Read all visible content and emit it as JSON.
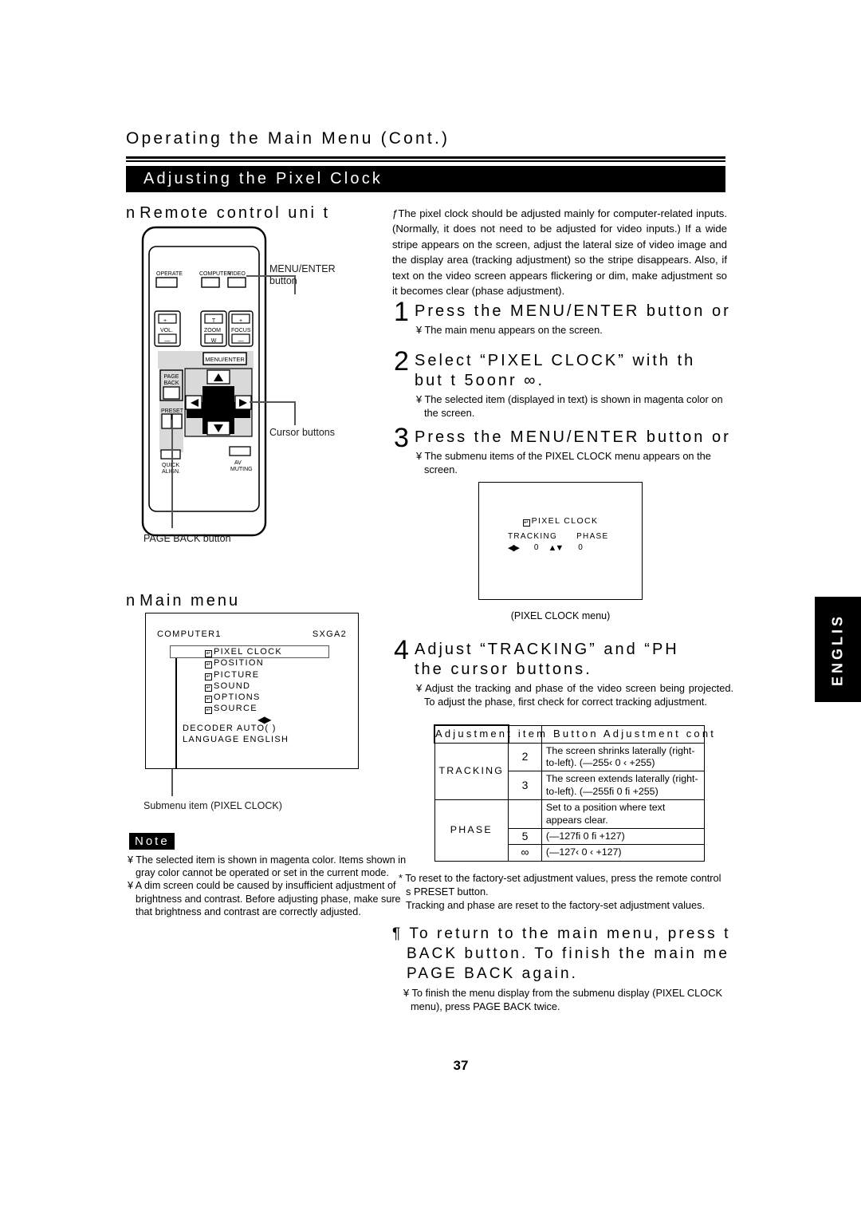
{
  "header": {
    "running_head": "Operating the Main Menu (Cont.)",
    "section_title": "Adjusting the Pixel Clock"
  },
  "left_column": {
    "remote_heading_bullet": "n",
    "remote_heading": "Remote control uni t",
    "mainmenu_heading_bullet": "n",
    "mainmenu_heading": "Main menu",
    "callouts": {
      "menu_enter": "MENU/ENTER\nbutton",
      "cursor": "Cursor buttons",
      "page_back": "PAGE BACK button",
      "submenu": "Submenu item (PIXEL CLOCK)"
    },
    "remote_labels": {
      "operate": "OPERATE",
      "computer": "COMPUTER",
      "video": "VIDEO",
      "vol": "VOL.",
      "zoom": "ZOOM",
      "focus": "FOCUS",
      "zoom_t": "T",
      "zoom_w": "W",
      "plus": "+",
      "minus": "—",
      "menu_enter": "MENU/ENTER",
      "page_back": "PAGE\nBACK",
      "preset": "PRESET",
      "quick_align": "QUICK\nALIGN.",
      "av_muting": "AV\nMUTING"
    },
    "osd_main": {
      "source": "COMPUTER1",
      "mode": "SXGA2",
      "items": [
        "PIXEL CLOCK",
        "POSITION",
        "PICTURE",
        "SOUND",
        "OPTIONS",
        "SOURCE"
      ],
      "selected_item": "PIXEL CLOCK",
      "arrows": "◀▶",
      "decoder": "DECODER AUTO(       )",
      "language": "LANGUAGE ENGLISH"
    },
    "note": {
      "label": "Note",
      "lines": [
        "¥ The selected item is shown in magenta color. Items shown in gray color cannot be operated or set in the current mode.",
        "¥ A dim screen could be caused by insufficient adjustment of brightness and contrast. Before adjusting phase, make sure that brightness and contrast are correctly adjusted."
      ]
    }
  },
  "right_column": {
    "intro": "ƒThe pixel clock should be adjusted mainly for computer-related inputs. (Normally, it does not need to be adjusted for video inputs.) If a wide stripe appears on the screen, adjust the lateral size of video image and the display area (tracking adjustment) so the stripe disappears. Also, if text on the video screen appears flickering or dim, make adjustment so it becomes clear (phase adjustment).",
    "steps": [
      {
        "num": "1",
        "title": "Press the MENU/ENTER button or",
        "sub": "¥ The main menu appears on the screen."
      },
      {
        "num": "2",
        "title": "Select “PIXEL CLOCK” with th",
        "title2": "but t 5oonr ∞.",
        "sub": "¥ The selected item (displayed in text) is shown in magenta color on the screen."
      },
      {
        "num": "3",
        "title": "Press the MENU/ENTER button or",
        "sub": "¥ The submenu items of the PIXEL CLOCK menu appears on the screen."
      },
      {
        "num": "4",
        "title": "Adjust “TRACKING” and “PH",
        "title2": "the cursor buttons.",
        "sub": "¥ Adjust the tracking and phase of the video screen being projected. To adjust the phase, first check for correct tracking adjustment."
      }
    ],
    "osd_pixel": {
      "title": "PIXEL CLOCK",
      "tracking_label": "TRACKING",
      "phase_label": "PHASE",
      "tracking_arrow": "◀▶",
      "tracking_value": "0",
      "phase_arrow": "▲▼",
      "phase_value": "0",
      "caption": "(PIXEL CLOCK menu)"
    },
    "lang_tab": "ENGLIS",
    "adj_table": {
      "header_text": "Adjustment item  Button        Adjustment cont",
      "columns": [
        "Adjustment item",
        "Button",
        "Adjustment content"
      ],
      "rows": [
        {
          "item": "TRACKING",
          "button": "2",
          "desc": "The screen shrinks laterally (right-to-left). (—255‹  0 ‹  +255)"
        },
        {
          "item": "",
          "button": "3",
          "desc": "The screen extends laterally (right-to-left). (—255ﬁ  0 ﬁ  +255)"
        },
        {
          "item": "PHASE",
          "button": "",
          "desc": "Set to a position where text appears clear."
        },
        {
          "item": "",
          "button": "5",
          "desc": "(—127ﬁ  0 ﬁ  +127)"
        },
        {
          "item": "",
          "button": "∞",
          "desc": "(—127‹   0 ‹   +127)"
        }
      ]
    },
    "footnote": [
      "* To reset to the factory-set adjustment values, press the remote control s PRESET button.",
      "Tracking and phase are reset to the factory-set adjustment values."
    ],
    "final_step": {
      "title": "¶ To return to the main menu, press t\nBACK button. To finish the main me\nPAGE BACK again.",
      "sub": "¥ To finish the menu display from the submenu display (PIXEL CLOCK menu), press PAGE BACK twice."
    }
  },
  "page_number": "37"
}
